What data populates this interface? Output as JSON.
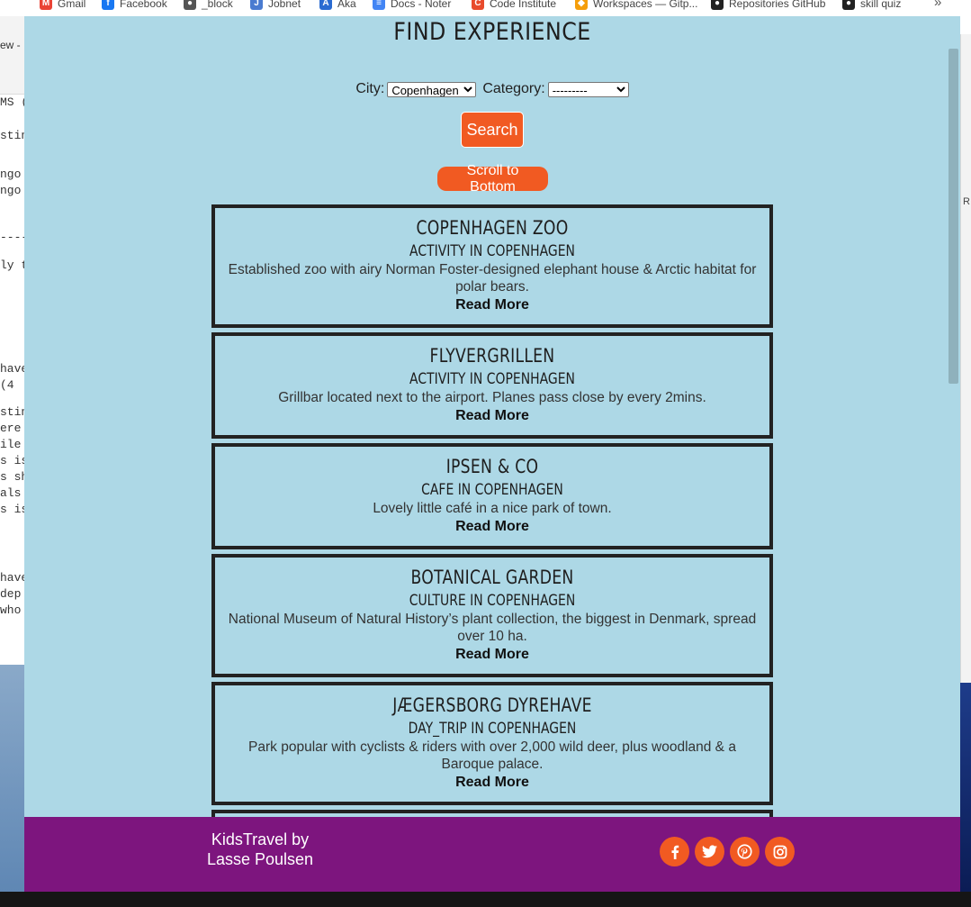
{
  "bookmarks": [
    {
      "label": "Gmail",
      "icon": "gmail-icon",
      "color": "#ea4335",
      "glyph": "M"
    },
    {
      "label": "Facebook",
      "icon": "facebook-icon",
      "color": "#1877f2",
      "glyph": "f"
    },
    {
      "label": "_block",
      "icon": "globe-icon",
      "color": "#555555",
      "glyph": "●"
    },
    {
      "label": "Jobnet",
      "icon": "jobnet-icon",
      "color": "#4a7bd0",
      "glyph": "J"
    },
    {
      "label": "Aka",
      "icon": "aka-icon",
      "color": "#2a6bd1",
      "glyph": "A"
    },
    {
      "label": "Docs - Noter",
      "icon": "docs-icon",
      "color": "#4285f4",
      "glyph": "≡"
    },
    {
      "label": "Code Institute",
      "icon": "code-institute-icon",
      "color": "#e84b2c",
      "glyph": "C"
    },
    {
      "label": "Workspaces — Gitp...",
      "icon": "gitpod-icon",
      "color": "#f59e0b",
      "glyph": "◆"
    },
    {
      "label": "Repositories GitHub",
      "icon": "github-icon",
      "color": "#222222",
      "glyph": "●"
    },
    {
      "label": "skill quiz",
      "icon": "github-icon",
      "color": "#222222",
      "glyph": "●"
    }
  ],
  "bookmarks_more": "»",
  "background": {
    "tab_text": "ew -",
    "code_lines": [
      "MS (",
      "stin",
      "ngo",
      "ngo",
      "----",
      "ly t",
      "have",
      " (4",
      "stin",
      "ere",
      "ile",
      "s is",
      "s sh",
      "  als",
      "s is",
      "have",
      " dep",
      " who"
    ],
    "right_mark": "R"
  },
  "page": {
    "title": "FIND EXPERIENCE",
    "city_label": "City:",
    "city_selected": "Copenhagen",
    "category_label": "Category:",
    "category_selected": "---------",
    "search_button": "Search",
    "scroll_button": "Scroll to Bottom"
  },
  "experiences": [
    {
      "title": "COPENHAGEN ZOO",
      "subtitle": "ACTIVITY IN COPENHAGEN",
      "description": "Established zoo with airy Norman Foster-designed elephant house & Arctic habitat for polar bears.",
      "link": "Read More"
    },
    {
      "title": "FLYVERGRILLEN",
      "subtitle": "ACTIVITY IN COPENHAGEN",
      "description": "Grillbar located next to the airport. Planes pass close by every 2mins.",
      "link": "Read More"
    },
    {
      "title": "IPSEN & CO",
      "subtitle": "CAFE IN COPENHAGEN",
      "description": "Lovely little café in a nice park of town.",
      "link": "Read More"
    },
    {
      "title": "BOTANICAL GARDEN",
      "subtitle": "CULTURE IN COPENHAGEN",
      "description": "National Museum of Natural History’s plant collection, the biggest in Denmark, spread over 10 ha.",
      "link": "Read More"
    },
    {
      "title": "JÆGERSBORG DYREHAVE",
      "subtitle": "DAY_TRIP IN COPENHAGEN",
      "description": "Park popular with cyclists & riders with over 2,000 wild deer, plus woodland & a Baroque palace.",
      "link": "Read More"
    }
  ],
  "footer": {
    "brand_line1": "KidsTravel by",
    "brand_line2": "Lasse Poulsen",
    "social": [
      {
        "icon": "facebook-icon",
        "glyph": "f"
      },
      {
        "icon": "twitter-icon",
        "glyph": "t"
      },
      {
        "icon": "pinterest-icon",
        "glyph": "p"
      },
      {
        "icon": "instagram-icon",
        "glyph": "ig"
      }
    ]
  },
  "colors": {
    "page_bg": "#add8e6",
    "accent": "#f15a22",
    "footer_bg": "#7d157e",
    "card_border": "#222222"
  }
}
